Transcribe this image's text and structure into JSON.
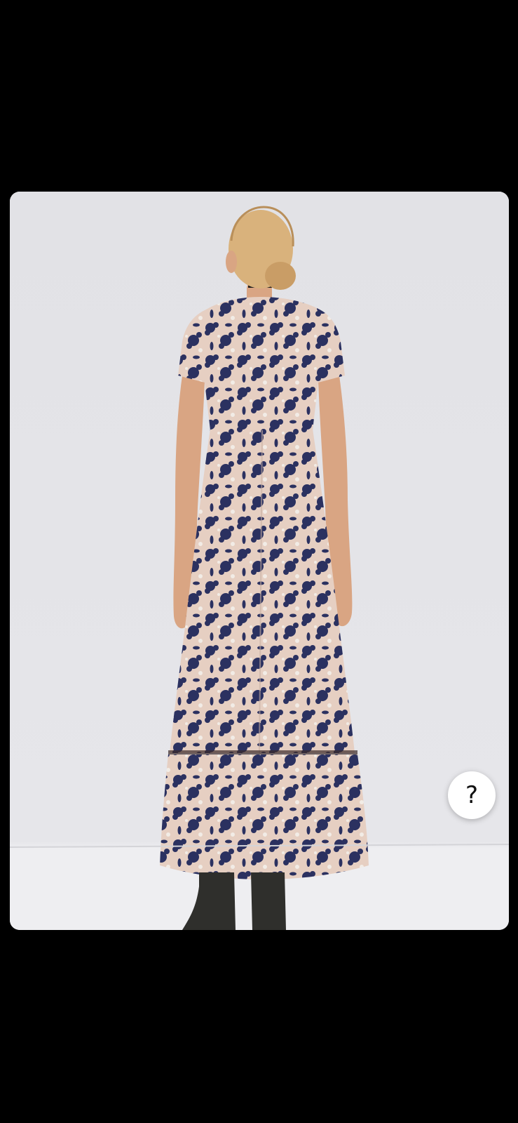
{
  "photo": {
    "subject": "model-back-view-floral-maxi-dress",
    "colors": {
      "backdrop": "#e4e4e8",
      "floor": "#ececf0",
      "dress_base": "#e6cfc2",
      "dress_print": "#2b3160",
      "skin": "#d9a583",
      "hair": "#d9b27c",
      "boots": "#2f2f2c"
    }
  },
  "help_button": {
    "label": "?",
    "icon": "question-mark-icon"
  }
}
